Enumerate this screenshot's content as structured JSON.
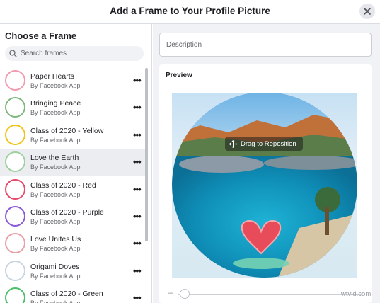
{
  "dialog": {
    "title": "Add a Frame to Your Profile Picture"
  },
  "sidebar": {
    "heading": "Choose a Frame",
    "search_placeholder": "Search frames",
    "frames": [
      {
        "name": "Paper Hearts",
        "by": "By Facebook App",
        "ring_color": "#f29bb0"
      },
      {
        "name": "Bringing Peace",
        "by": "By Facebook App",
        "ring_color": "#7fb77e"
      },
      {
        "name": "Class of 2020 - Yellow",
        "by": "By Facebook App",
        "ring_color": "#f0c419"
      },
      {
        "name": "Love the Earth",
        "by": "By Facebook App",
        "ring_color": "#9fd0a0"
      },
      {
        "name": "Class of 2020 - Red",
        "by": "By Facebook App",
        "ring_color": "#e8496a"
      },
      {
        "name": "Class of 2020 - Purple",
        "by": "By Facebook App",
        "ring_color": "#8c5bd6"
      },
      {
        "name": "Love Unites Us",
        "by": "By Facebook App",
        "ring_color": "#e9a0a8"
      },
      {
        "name": "Origami Doves",
        "by": "By Facebook App",
        "ring_color": "#c7d4e2"
      },
      {
        "name": "Class of 2020 - Green",
        "by": "By Facebook App",
        "ring_color": "#4cbf6b"
      }
    ],
    "selected_index": 3,
    "more_glyph": "•••"
  },
  "main": {
    "description_placeholder": "Description",
    "preview_label": "Preview",
    "drag_label": "Drag to Reposition",
    "zoom_minus": "–"
  },
  "watermark": "wtvid.com"
}
